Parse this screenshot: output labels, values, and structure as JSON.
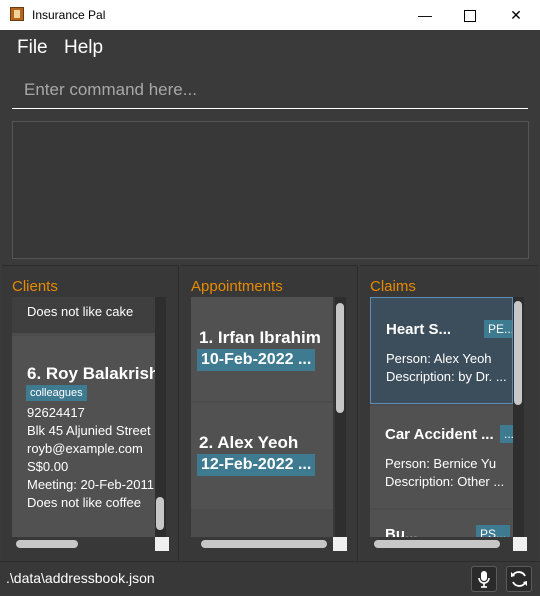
{
  "window": {
    "title": "Insurance Pal"
  },
  "menu": {
    "file": "File",
    "help": "Help"
  },
  "command": {
    "placeholder": "Enter command here...",
    "value": ""
  },
  "panels": {
    "clients": {
      "title": "Clients",
      "partial_line": "Does not like cake",
      "card": {
        "index_name": "6.  Roy Balakrish",
        "tag": "colleagues",
        "phone": "92624417",
        "address": "Blk 45 Aljunied Street",
        "email": "royb@example.com",
        "income": "S$0.00",
        "meeting": "Meeting: 20-Feb-2011",
        "remark": "Does not like coffee"
      }
    },
    "appointments": {
      "title": "Appointments",
      "items": [
        {
          "index_name": "1.  Irfan Ibrahim",
          "date": "10-Feb-2022 ..."
        },
        {
          "index_name": "2.  Alex Yeoh",
          "date": "12-Feb-2022 ..."
        }
      ]
    },
    "claims": {
      "title": "Claims",
      "items": [
        {
          "title": "Heart S...",
          "tag": "PE...",
          "person": "Person: Alex Yeoh",
          "description": "Description: by Dr. ..."
        },
        {
          "title": "Car Accident ...",
          "tag": "...",
          "person": "Person: Bernice Yu",
          "description": "Description: Other ..."
        },
        {
          "title": "Bu...",
          "tag": "PS..."
        }
      ]
    }
  },
  "status": {
    "path": ".\\data\\addressbook.json"
  },
  "icons": {
    "mic": "microphone-icon",
    "refresh": "refresh-icon"
  },
  "colors": {
    "accent": "#e78a00",
    "tag": "#3e7b91",
    "background": "#3a3a3a"
  }
}
